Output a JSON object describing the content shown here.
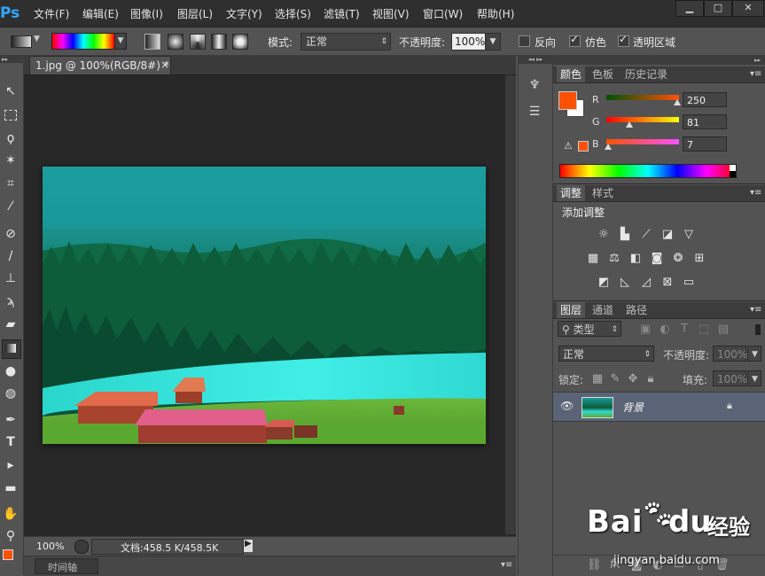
{
  "app": {
    "logo": "Ps"
  },
  "menubar": {
    "items": [
      "文件(F)",
      "编辑(E)",
      "图像(I)",
      "图层(L)",
      "文字(Y)",
      "选择(S)",
      "滤镜(T)",
      "视图(V)",
      "窗口(W)",
      "帮助(H)"
    ],
    "window_controls": {
      "minimize": "▁",
      "restore": "□",
      "close": "✕"
    }
  },
  "options_bar": {
    "mode_label": "模式:",
    "mode_value": "正常",
    "opacity_label": "不透明度:",
    "opacity_value": "100%",
    "reverse_label": "反向",
    "reverse_checked": false,
    "dither_label": "仿色",
    "dither_checked": true,
    "transparency_label": "透明区域",
    "transparency_checked": true
  },
  "toolbar": {
    "tools": [
      "move-tool-icon",
      "marquee-tool-icon",
      "lasso-tool-icon",
      "magic-wand-tool-icon",
      "crop-tool-icon",
      "eyedropper-tool-icon",
      "healing-brush-tool-icon",
      "brush-tool-icon",
      "clone-stamp-tool-icon",
      "history-brush-tool-icon",
      "eraser-tool-icon",
      "gradient-tool-icon",
      "blur-tool-icon",
      "dodge-tool-icon",
      "pen-tool-icon",
      "type-tool-icon",
      "path-selection-tool-icon",
      "rectangle-tool-icon",
      "hand-tool-icon",
      "zoom-tool-icon"
    ]
  },
  "document": {
    "tab_title": "1.jpg @ 100%(RGB/8#) *",
    "tab_close": "×",
    "zoom": "100%",
    "doc_info": "文档:458.5 K/458.5K"
  },
  "timeline": {
    "label": "时间轴"
  },
  "color_panel": {
    "tabs": [
      "颜色",
      "色板",
      "历史记录"
    ],
    "foreground_color": "#fa5107",
    "background_color": "#ffffff",
    "channels": [
      {
        "label": "R",
        "value": "250",
        "fraction": 0.98
      },
      {
        "label": "G",
        "value": "81",
        "fraction": 0.32
      },
      {
        "label": "B",
        "value": "7",
        "fraction": 0.03
      }
    ]
  },
  "adjustments_panel": {
    "tabs": [
      "调整",
      "样式"
    ],
    "title": "添加调整"
  },
  "layers_panel": {
    "tabs": [
      "图层",
      "通道",
      "路径"
    ],
    "filter_value": "类型",
    "blend_mode": "正常",
    "opacity_label": "不透明度:",
    "opacity_value": "100%",
    "lock_label": "锁定:",
    "fill_label": "填充:",
    "fill_value": "100%",
    "layers": [
      {
        "name": "背景",
        "visible": true,
        "locked": true
      }
    ]
  },
  "watermark": {
    "brand": "Bai",
    "brand2": "du",
    "chinese": "经验",
    "url": "jingyan.baidu.com"
  }
}
